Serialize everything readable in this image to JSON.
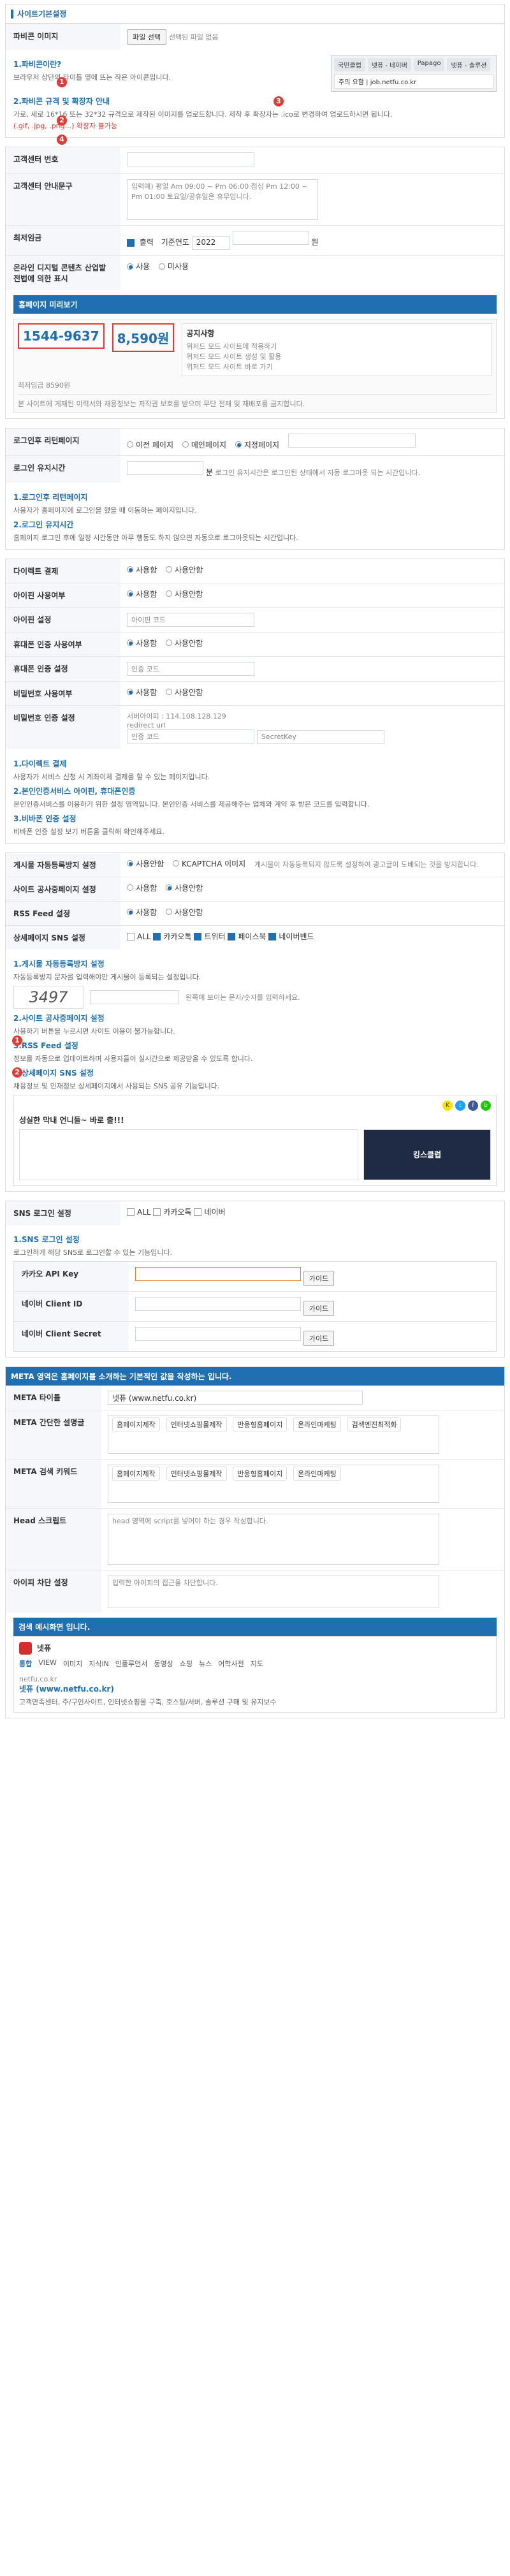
{
  "site_basic": {
    "title": "사이트기본설정",
    "favicon_label": "파비콘 이미지",
    "favicon_btn": "파일 선택",
    "favicon_hint": "선택된 파일 없음",
    "favicon_help_title1": "1.파비콘이란?",
    "favicon_help_desc1": "브라우저 상단의 타이틀 옆에 뜨는 작은 아이콘입니다.",
    "favicon_help_title2": "2.파비콘 규격 및 확장자 안내",
    "favicon_help_desc2": "가로, 세로 16*16 또는 32*32 규격으로 제작된 이미지를 업로드합니다. 제작 후 확장자는 .ico로 변경하여 업로드하시면 됩니다.",
    "favicon_help_desc3": "(.gif, .jpg, .png...) 확장자 불가능",
    "browser_tabs": [
      "국민클럽",
      "넷퓨 - 네이버",
      "Papago",
      "넷퓨 - 솔루션"
    ],
    "browser_addr": "주의 요함 | job.netfu.co.kr"
  },
  "customer": {
    "phone_label": "고객센터 번호",
    "guide_label": "고객센터 안내문구",
    "guide_text": "입력예) 평일 Am 09:00 ~ Pm 06:00 점심 Pm 12:00 ~ Pm 01:00 토요일/공휴일은 휴무입니다.",
    "wage_label": "최저임금",
    "wage_checkbox": "출력",
    "wage_year_prefix": "기준연도",
    "wage_year": "2022",
    "wage_unit": "원",
    "pay_label": "온라인 디지털 콘텐츠 산업발전법에 의한 표시",
    "pay_opt1": "사용",
    "pay_opt2": "미사용",
    "preview_head": "홈페이지 미리보기",
    "preview_phone": "1544-9637",
    "preview_wage": "8,590원",
    "preview_wage_label": "최저임금 8590원",
    "preview_notice_title": "공지사항",
    "preview_notice_items": [
      "위저드 모드 사이트에 적용하기",
      "위저드 모드 사이트 생성 및 활용",
      "위저드 모드 사이트 바로 가기"
    ],
    "preview_footer_text": "본 사이트에 게재된 이력서와 채용정보는 저작권 보호를 받으며 무단 전재 및 재배포를 금지합니다."
  },
  "login": {
    "redirect_label": "로그인후 리턴페이지",
    "redirect_opts": [
      "이전 페이지",
      "메인페이지",
      "지정페이지"
    ],
    "keep_label": "로그인 유지시간",
    "keep_value": "분",
    "keep_hint": "로그인 유지시간은 로그인된 상태에서 자동 로그아웃 되는 시간입니다.",
    "help_title1": "1.로그인후 리턴페이지",
    "help_desc1": "사용자가 홈페이지에 로그인을 했을 때 이동하는 페이지입니다.",
    "help_title2": "2.로그인 유지시간",
    "help_desc2": "홈페이지 로그인 후에 일정 시간동안 아무 행동도 하지 않으면 자동으로 로그아웃되는 시간입니다."
  },
  "auth": {
    "direct_pay_label": "다이렉트 결제",
    "ipin_use_label": "아이핀 사용여부",
    "ipin_set_label": "아이핀 설정",
    "ipin_code_placeholder": "아이핀 코드",
    "phone_auth_use_label": "휴대폰 인증 사용여부",
    "phone_auth_set_label": "휴대폰 인증 설정",
    "phone_auth_code_placeholder": "인증 코드",
    "pw_auth_use_label": "비밀번호 사용여부",
    "pw_auth_set_label": "비밀번호 인증 설정",
    "server_ip": "서버아이피 : 114.108.128.129",
    "redirect_url": "redirect url",
    "secret_key": "SecretKey",
    "help_title1": "1.다이렉트 결제",
    "help_desc1": "사용자가 서비스 신청 시 계좌이체 결제를 할 수 있는 페이지입니다.",
    "help_title2": "2.본인인증서비스 아이핀, 휴대폰인증",
    "help_desc2": "본인인증서비스를 이용하기 위한 설정 영역입니다. 본인인증 서비스를 제공해주는 업체와 계약 후 받은 코드를 입력합니다.",
    "help_title3": "3.비바폰 인증 설정",
    "help_desc3": "비바폰 인증 설정 보기 버튼을 클릭해 확인해주세요."
  },
  "sns": {
    "auto_label": "게시물 자동등록방지 설정",
    "auto_opts": [
      "사용안함",
      "KCAPTCHA 이미지"
    ],
    "auto_hint": "게시물이 자동등록되지 않도록 설정하여 광고글이 도배되는 것을 방지합니다.",
    "public_label": "사이트 공사중페이지 설정",
    "public_opts": [
      "사용함",
      "사용안함"
    ],
    "rss_label": "RSS Feed 설정",
    "rss_opts": [
      "사용함",
      "사용안함"
    ],
    "share_label": "상세페이지 SNS 설정",
    "share_opts": [
      "ALL",
      "카카오톡",
      "트위터",
      "페이스북",
      "네이버밴드"
    ],
    "help_title1": "1.게시물 자동등록방지 설정",
    "help_desc1": "자동등록방지 문자를 입력해야만 게시물이 등록되는 설정입니다.",
    "captcha_value": "3497",
    "captcha_hint": "왼쪽에 보이는 문자/숫자를 입력하세요.",
    "help_title2": "2.사이트 공사중페이지 설정",
    "help_desc2": "사용하기 버튼을 누르시면 사이트 이용이 불가능합니다.",
    "help_title3": "3.RSS Feed 설정",
    "help_desc3": "정보를 자동으로 업데이트하며 사용자들이 실시간으로 제공받을 수 있도록 합니다.",
    "help_title4": "4.상세페이지 SNS 설정",
    "help_desc4": "채용정보 및 인재정보 상세페이지에서 사용되는 SNS 공유 기능입니다.",
    "preview_title": "성실한 막내 언니들~ 바로 출!!!",
    "preview_logo_text": "킹스클럽"
  },
  "sns_login": {
    "label": "SNS 로그인 설정",
    "opts": [
      "ALL",
      "카카오톡",
      "네이버"
    ],
    "help_title": "1.SNS 로그인 설정",
    "help_desc": "로그인하게 해당 SNS로 로그인할 수 있는 기능입니다.",
    "kakao_label": "카카오 API Key",
    "naver_id_label": "네이버 Client ID",
    "naver_secret_label": "네이버 Client Secret",
    "guide_btn": "가이드"
  },
  "meta": {
    "head": "META 영역은 홈페이지를 소개하는 기본적인 값을 작성하는 입니다.",
    "title_label": "META 타이틀",
    "title_value": "넷퓨 (www.netfu.co.kr)",
    "desc_label": "META 간단한 설명글",
    "keywords_label": "META 검색 키워드",
    "keywords": [
      "홈페이지제작",
      "인터넷쇼핑몰제작",
      "반응형홈페이지",
      "온라인마케팅",
      "검색엔진최적화"
    ],
    "head_script_label": "Head 스크립트",
    "head_script_hint": "head 영역에 script를 넣어야 하는 경우 작성합니다.",
    "verify_label": "아이피 차단 설정",
    "verify_hint": "입력한 아이피의 접근을 차단합니다.",
    "search_example_label": "검색 예시화면 입니다.",
    "search_brand": "넷퓨",
    "search_tabs": [
      "통합",
      "VIEW",
      "이미지",
      "지식iN",
      "인플루언서",
      "동영상",
      "쇼핑",
      "뉴스",
      "어학사전",
      "지도"
    ],
    "result_url": "netfu.co.kr",
    "result_title": "넷퓨 (www.netfu.co.kr)",
    "result_desc": "고객만족센터, 주/구인사이트, 인터넷쇼핑몰 구축, 호스팅/서버, 솔루션 구매 및 유지보수"
  },
  "colors": {
    "blue": "#1f6fb2",
    "red": "#e53935"
  }
}
